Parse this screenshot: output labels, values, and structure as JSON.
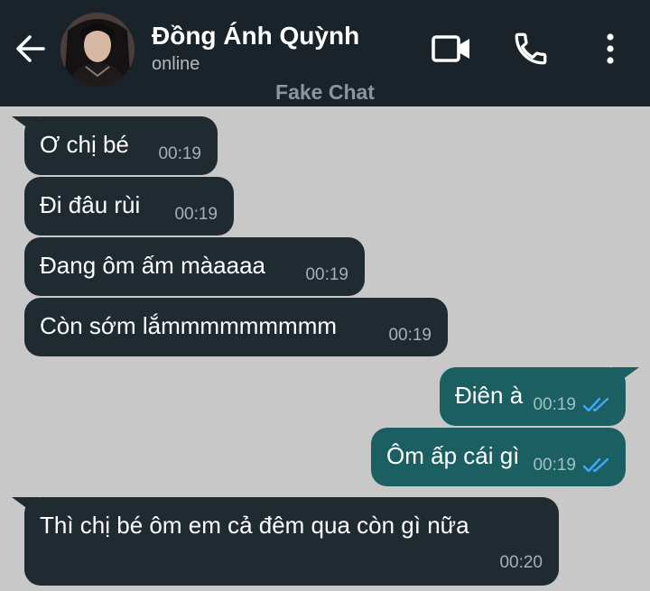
{
  "header": {
    "contact_name": "Đồng Ánh Quỳnh",
    "status": "online",
    "subtitle": "Fake Chat",
    "icons": [
      "back-arrow-icon",
      "video-call-icon",
      "phone-icon",
      "more-vertical-icon"
    ]
  },
  "colors": {
    "header_bg": "#1b232a",
    "chat_bg": "#c8c8c8",
    "incoming_bubble": "#202a31",
    "outgoing_bubble": "#1b5f63",
    "read_tick": "#3fa9f5"
  },
  "messages": [
    {
      "direction": "in",
      "text": "Ơ chị bé",
      "time": "00:19"
    },
    {
      "direction": "in",
      "text": "Đi đâu rùi",
      "time": "00:19"
    },
    {
      "direction": "in",
      "text": "Đang ôm ấm màaaaa",
      "time": "00:19"
    },
    {
      "direction": "in",
      "text": "Còn sớm lắmmmmmmmmm",
      "time": "00:19"
    },
    {
      "direction": "out",
      "text": "Điên à",
      "time": "00:19",
      "status": "read"
    },
    {
      "direction": "out",
      "text": "Ôm ấp cái gì",
      "time": "00:19",
      "status": "read"
    },
    {
      "direction": "in",
      "text": "Thì chị bé ôm em cả đêm qua còn gì nữa",
      "time": "00:20"
    }
  ]
}
